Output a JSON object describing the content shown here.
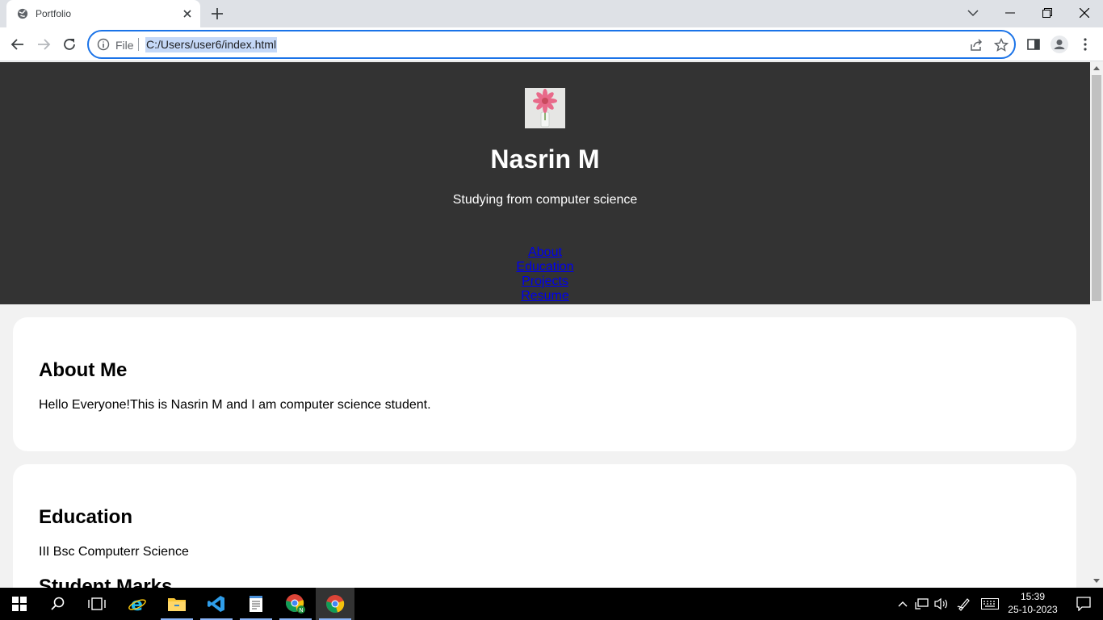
{
  "browser": {
    "tab_title": "Portfolio",
    "address_scheme": "File",
    "address_url": "C:/Users/user6/index.html"
  },
  "page": {
    "name": "Nasrin M",
    "tagline": "Studying from computer science",
    "nav": [
      "About",
      "Education",
      "Projects",
      "Resume"
    ],
    "about": {
      "heading": "About Me",
      "text": "Hello Everyone!This is Nasrin M and I am computer science student."
    },
    "education": {
      "heading": "Education",
      "text": "III Bsc Computerr Science",
      "subheading": "Student Marks"
    }
  },
  "taskbar": {
    "time": "15:39",
    "date": "25-10-2023"
  },
  "colors": {
    "header_bg": "#333333",
    "link": "#0000ee",
    "omnibox_border": "#1a73e8"
  }
}
